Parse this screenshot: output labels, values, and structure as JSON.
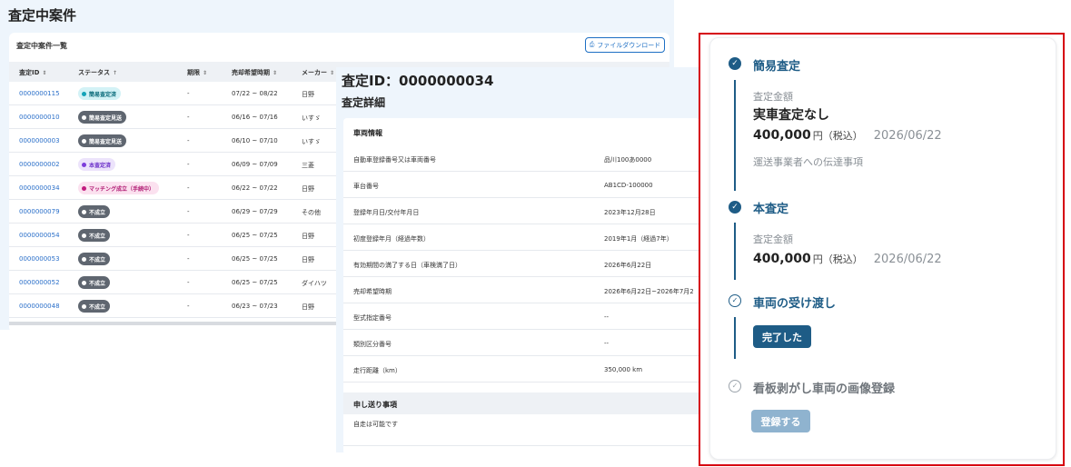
{
  "list": {
    "page_title": "査定中案件",
    "card_title": "査定中案件一覧",
    "download_label": "ファイルダウンロード",
    "columns": [
      "査定ID",
      "ステータス",
      "期限",
      "売却希望時期",
      "メーカー"
    ],
    "rows": [
      {
        "id": "0000000115",
        "status": "簡易査定済",
        "status_key": "cyan",
        "deadline": "-",
        "period": "07/22 ~ 08/22",
        "maker": "日野"
      },
      {
        "id": "0000000010",
        "status": "簡易査定見送",
        "status_key": "grey",
        "deadline": "-",
        "period": "06/16 ~ 07/16",
        "maker": "いすゞ"
      },
      {
        "id": "0000000003",
        "status": "簡易査定見送",
        "status_key": "grey",
        "deadline": "-",
        "period": "06/10 ~ 07/10",
        "maker": "いすゞ"
      },
      {
        "id": "0000000002",
        "status": "本査定済",
        "status_key": "purple",
        "deadline": "-",
        "period": "06/09 ~ 07/09",
        "maker": "三菱"
      },
      {
        "id": "0000000034",
        "status": "マッチング成立（手続中）",
        "status_key": "pink",
        "deadline": "-",
        "period": "06/22 ~ 07/22",
        "maker": "日野"
      },
      {
        "id": "0000000079",
        "status": "不成立",
        "status_key": "grey",
        "deadline": "-",
        "period": "06/29 ~ 07/29",
        "maker": "その他"
      },
      {
        "id": "0000000054",
        "status": "不成立",
        "status_key": "grey",
        "deadline": "-",
        "period": "06/25 ~ 07/25",
        "maker": "日野"
      },
      {
        "id": "0000000053",
        "status": "不成立",
        "status_key": "grey",
        "deadline": "-",
        "period": "06/25 ~ 07/25",
        "maker": "日野"
      },
      {
        "id": "0000000052",
        "status": "不成立",
        "status_key": "grey",
        "deadline": "-",
        "period": "06/25 ~ 07/25",
        "maker": "ダイハツ"
      },
      {
        "id": "0000000048",
        "status": "不成立",
        "status_key": "grey",
        "deadline": "-",
        "period": "06/23 ~ 07/23",
        "maker": "日野"
      }
    ]
  },
  "status_colors": {
    "cyan": {
      "bg": "#d3f2f6",
      "fg": "#0a6b7a",
      "dot": "#14a3b8"
    },
    "grey": {
      "bg": "#5f6670",
      "fg": "#ffffff",
      "dot": "#ffffff"
    },
    "purple": {
      "bg": "#ece3fb",
      "fg": "#6b2fc9",
      "dot": "#7d3ddb"
    },
    "pink": {
      "bg": "#fbe1ef",
      "fg": "#b01a73",
      "dot": "#c21b7f"
    }
  },
  "detail": {
    "id_title": "査定ID：0000000034",
    "subtitle": "査定詳細",
    "vehicle_heading": "車両情報",
    "rows": [
      {
        "label": "自動車登録番号又は車両番号",
        "value": "品川100あ0000"
      },
      {
        "label": "車台番号",
        "value": "AB1CD-100000"
      },
      {
        "label": "登録年月日/交付年月日",
        "value": "2023年12月28日"
      },
      {
        "label": "初度登録年月（経過年数）",
        "value": "2019年1月（経過7年）"
      },
      {
        "label": "有効期間の満了する日（車検満了日）",
        "value": "2026年6月22日"
      },
      {
        "label": "売却希望時期",
        "value": "2026年6月22日~2026年7月2"
      },
      {
        "label": "型式指定番号",
        "value": "--"
      },
      {
        "label": "類別区分番号",
        "value": "--"
      },
      {
        "label": "走行距離（km）",
        "value": "350,000 km"
      }
    ],
    "notes_heading": "申し送り事項",
    "notes_text": "自走は可能です"
  },
  "timeline": {
    "step1": {
      "title": "簡易査定",
      "label": "査定金額",
      "main": "実車査定なし",
      "amount": "400,000",
      "unit": "円（税込）",
      "date": "2026/06/22",
      "note": "運送事業者への伝達事項"
    },
    "step2": {
      "title": "本査定",
      "label": "査定金額",
      "amount": "400,000",
      "unit": "円（税込）",
      "date": "2026/06/22"
    },
    "step3": {
      "title": "車両の受け渡し",
      "button": "完了した"
    },
    "step4": {
      "title": "看板剥がし車両の画像登録",
      "button": "登録する"
    }
  }
}
